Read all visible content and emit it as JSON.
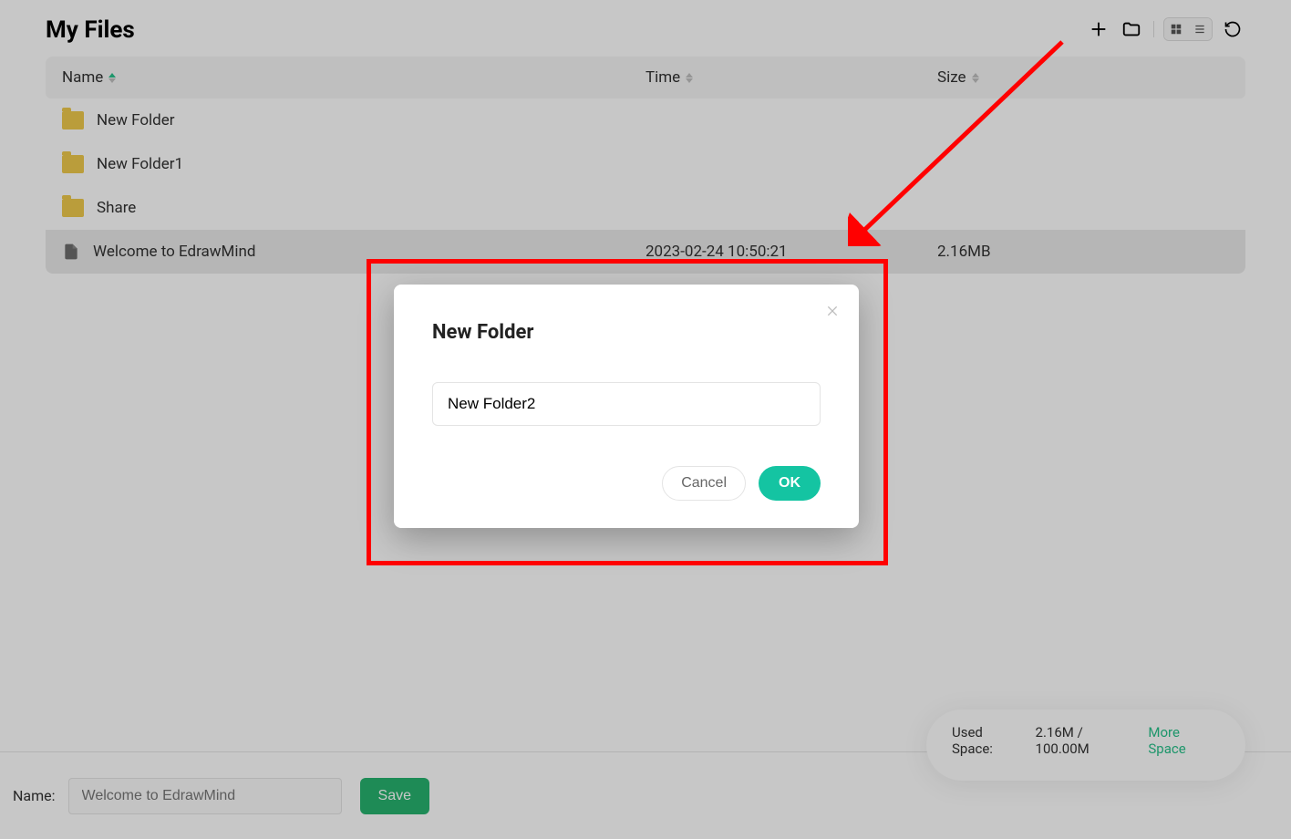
{
  "page": {
    "title": "My Files"
  },
  "columns": {
    "name": "Name",
    "time": "Time",
    "size": "Size"
  },
  "rows": [
    {
      "type": "folder",
      "name": "New Folder",
      "time": "",
      "size": ""
    },
    {
      "type": "folder",
      "name": "New Folder1",
      "time": "",
      "size": ""
    },
    {
      "type": "folder",
      "name": "Share",
      "time": "",
      "size": ""
    },
    {
      "type": "file",
      "name": "Welcome to EdrawMind",
      "time": "2023-02-24 10:50:21",
      "size": "2.16MB"
    }
  ],
  "footer": {
    "name_label": "Name:",
    "name_value": "Welcome to EdrawMind",
    "save_label": "Save"
  },
  "storage": {
    "label": "Used Space:",
    "value": "2.16M / 100.00M",
    "more": "More Space"
  },
  "modal": {
    "title": "New Folder",
    "input_value": "New Folder2",
    "cancel": "Cancel",
    "ok": "OK"
  }
}
